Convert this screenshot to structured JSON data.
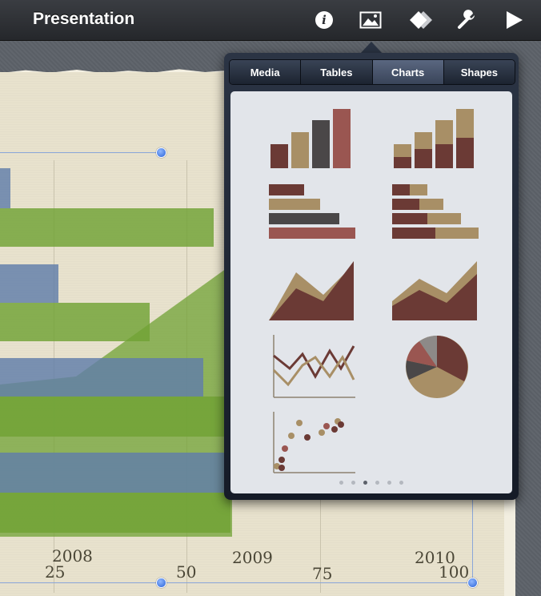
{
  "toolbar": {
    "title": "Presentation",
    "icons": [
      "info-icon",
      "media-icon",
      "animate-icon",
      "tools-icon",
      "play-icon"
    ]
  },
  "slide": {
    "axis_labels": [
      {
        "year": "2008",
        "tick": "25"
      },
      {
        "tick": "50"
      },
      {
        "year": "2009",
        "tick": "75"
      },
      {
        "year": "2010",
        "tick": "100"
      }
    ],
    "colors": {
      "bar_blue": "#607eaa",
      "bar_green": "#70a234",
      "paper": "#e8e2cd"
    }
  },
  "popover": {
    "tabs": [
      {
        "label": "Media",
        "active": false
      },
      {
        "label": "Tables",
        "active": false
      },
      {
        "label": "Charts",
        "active": true
      },
      {
        "label": "Shapes",
        "active": false
      }
    ],
    "chart_types": [
      "column-chart",
      "stacked-column-chart",
      "bar-chart",
      "stacked-bar-chart",
      "area-chart",
      "stacked-area-chart",
      "line-chart",
      "pie-chart",
      "scatter-chart"
    ],
    "page_count": 6,
    "current_page": 3
  }
}
